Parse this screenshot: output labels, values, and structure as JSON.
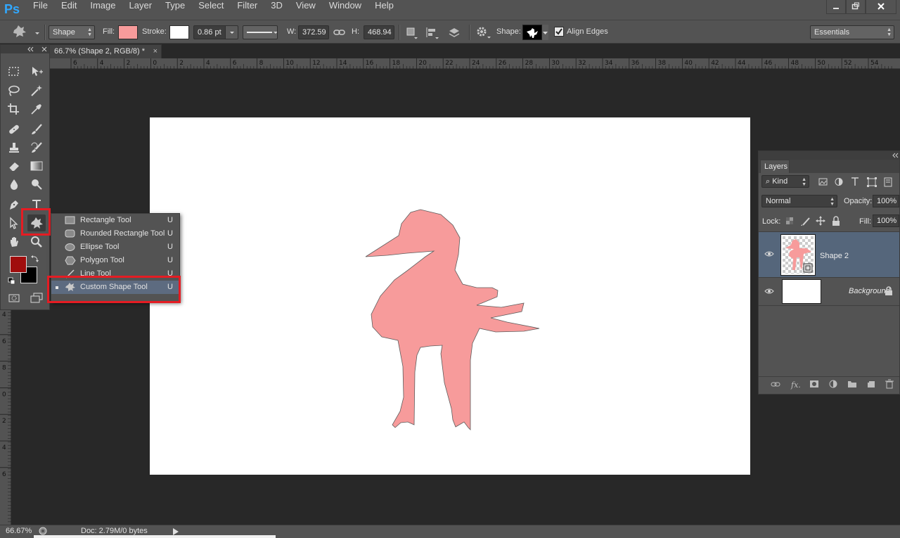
{
  "app": {
    "logo": "Ps",
    "menu": [
      "File",
      "Edit",
      "Image",
      "Layer",
      "Type",
      "Select",
      "Filter",
      "3D",
      "View",
      "Window",
      "Help"
    ],
    "window_controls": [
      "minimize-icon",
      "restore-icon",
      "close-icon"
    ]
  },
  "options": {
    "tool_mode": "Shape",
    "fill_label": "Fill:",
    "fill_color": "#f79b9b",
    "stroke_label": "Stroke:",
    "stroke_color": "#ffffff",
    "stroke_width": "0.86 pt",
    "w_label": "W:",
    "w_value": "372.59 p",
    "h_label": "H:",
    "h_value": "468.94 p",
    "shape_label": "Shape:",
    "align_edges_label": "Align Edges",
    "align_edges_checked": true,
    "workspace": "Essentials"
  },
  "document": {
    "tab_title": "66.7% (Shape 2, RGB/8) *",
    "close": "×",
    "ruler_top": [
      "6",
      "4",
      "2",
      "0",
      "2",
      "4",
      "6",
      "8",
      "10",
      "12",
      "14",
      "16",
      "18",
      "20",
      "22",
      "24",
      "26",
      "28",
      "30",
      "32",
      "34",
      "36",
      "38",
      "40",
      "42",
      "44",
      "46",
      "48",
      "50",
      "52",
      "54"
    ],
    "ruler_left": [
      "4",
      "6",
      "8",
      "0",
      "2",
      "4",
      "6"
    ],
    "shape_color": "#f79b9b"
  },
  "toolbox": {
    "foreground_color": "#a00d0d",
    "background_color": "#000000"
  },
  "flyout": {
    "items": [
      {
        "label": "Rectangle Tool",
        "key": "U",
        "icon": "rectangle-icon"
      },
      {
        "label": "Rounded Rectangle Tool",
        "key": "U",
        "icon": "rounded-rectangle-icon"
      },
      {
        "label": "Ellipse Tool",
        "key": "U",
        "icon": "ellipse-icon"
      },
      {
        "label": "Polygon Tool",
        "key": "U",
        "icon": "polygon-icon"
      },
      {
        "label": "Line Tool",
        "key": "U",
        "icon": "line-icon"
      },
      {
        "label": "Custom Shape Tool",
        "key": "U",
        "icon": "custom-shape-icon",
        "active": true
      }
    ]
  },
  "layers": {
    "tab": "Layers",
    "filter": "Kind",
    "blend_mode": "Normal",
    "opacity_label": "Opacity:",
    "opacity": "100%",
    "lock_label": "Lock:",
    "fill_label": "Fill:",
    "fill": "100%",
    "items": [
      {
        "name": "Shape 2",
        "selected": true
      },
      {
        "name": "Background",
        "selected": false,
        "locked": true
      }
    ]
  },
  "status": {
    "zoom": "66.67%",
    "doc": "Doc: 2.79M/0 bytes"
  }
}
